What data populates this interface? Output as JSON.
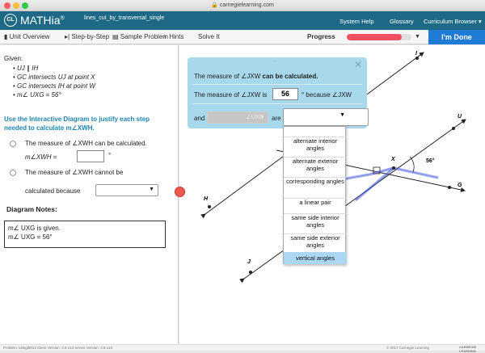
{
  "browser": {
    "url": "carnegielearning.com"
  },
  "app": {
    "logo_text": "CL",
    "brand": "MATHia",
    "brand_mark": "®",
    "file_name": "lines_cut_by_transversal_single",
    "menu": [
      "System Help",
      "Glossary",
      "Curriculum Browser ▾"
    ]
  },
  "toolbar": {
    "unit_overview": "Unit Overview",
    "step_by_step": "Step-by-Step",
    "sample_problem": "Sample Problem",
    "hints": "Hints",
    "solve_it": "Solve It",
    "progress_label": "Progress",
    "progress_value": 0.85,
    "progress_color": "#ef4f5f",
    "done_label": "I'm Done"
  },
  "left_panel": {
    "given_title": "Given:",
    "given": [
      "UJ ∥ IH",
      "GC intersects UJ at point X",
      "GC intersects IH at point W",
      "m∠ UXG = 56°"
    ],
    "instruction": "Use the Interactive Diagram to justify each step needed to calculate m∠XWH.",
    "option1": "The measure of ∠XWH can be calculated.",
    "option1_input_label": "m∠XWH =",
    "degree": "°",
    "option2": "The measure of ∠XWH cannot be",
    "option2b": "calculated because",
    "notes_title": "Diagram Notes:",
    "notes": [
      "m∠ UXG is given.",
      "m∠ UXG = 56°"
    ]
  },
  "popup": {
    "line1_pre": "The measure of ∠JXW",
    "line1_post": "can be calculated.",
    "line2_pre": "The measure of ∠JXW is",
    "answer": "56",
    "line2_post": "° because ∠JXW",
    "and_label": "and",
    "gray_select": "∠UXG",
    "are_label": "are",
    "dropdown_options": [
      "alternate interior angles",
      "alternate exterior angles",
      "corresponding angles",
      "a linear pair",
      "same side interior angles",
      "same side exterior angles",
      "vertical angles"
    ],
    "highlighted_option": "vertical angles"
  },
  "diagram": {
    "points": [
      "I",
      "U",
      "X",
      "G",
      "H",
      "J"
    ],
    "angle_label": "56°"
  },
  "footer": {
    "left": "Problem: ldskgl6013   Client Version: 2.8.113   Server Version: 2.8.113",
    "right": "© 2017 Carnegie Learning",
    "logo": "CARNEGIE LEARNING"
  }
}
